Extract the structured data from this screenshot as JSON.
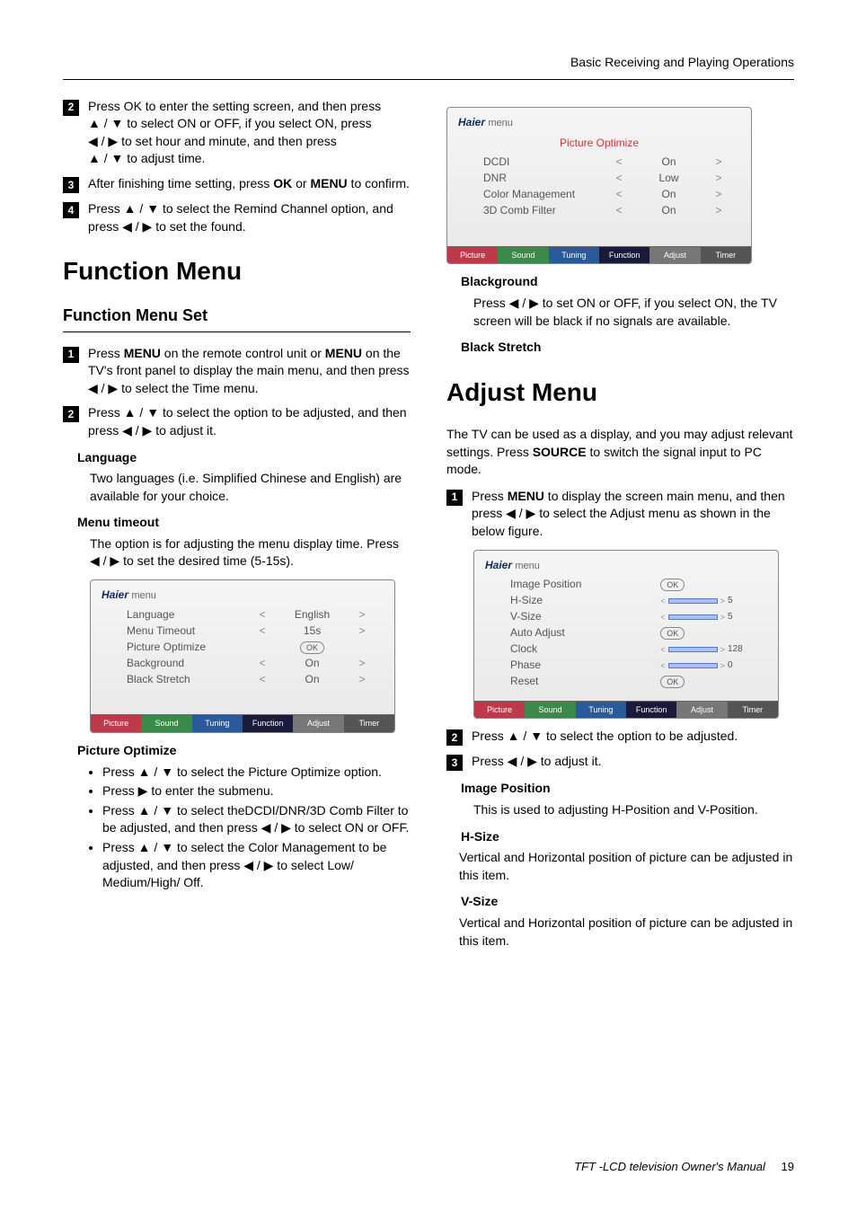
{
  "header": {
    "title": "Basic Receiving and Playing Operations"
  },
  "left": {
    "step2": {
      "l1": "Press OK to enter the setting screen, and then press",
      "l2a": "▲ / ▼ to select ON or OFF, if you select ON, press",
      "l3a": "◀ / ▶ to set hour and minute, and then press",
      "l4a": "▲ / ▼ to adjust time."
    },
    "step3": {
      "text_a": "After finishing time setting, press ",
      "ok": "OK",
      "or": " or ",
      "menu": "MENU",
      "text_b": " to confirm."
    },
    "step4": {
      "text_a": "Press ▲ / ▼ to select the Remind Channel option, and press ◀ / ▶ to set the found."
    },
    "h1": "Function Menu",
    "h2": "Function Menu Set",
    "fstep1": {
      "a": "Press ",
      "m": "MENU",
      "b": " on the remote control unit or ",
      "m2": "MENU",
      "c": " on the TV's front panel to display the main menu, and then press ◀ / ▶ to select the Time menu."
    },
    "fstep2": {
      "text": "Press ▲ / ▼ to select the option to be adjusted, and then press ◀ / ▶ to adjust it."
    },
    "lang_h": "Language",
    "lang_t": "Two languages (i.e. Simplified Chinese and English) are available for your choice.",
    "mt_h": "Menu timeout",
    "mt_t": "The option is for adjusting the menu display time. Press ◀ / ▶ to set the desired time (5-15s).",
    "menu1": {
      "brand": "Haier",
      "brand_sub": "menu",
      "rows": [
        {
          "lbl": "Language",
          "lt": "<",
          "val": "English",
          "gt": ">"
        },
        {
          "lbl": "Menu Timeout",
          "lt": "<",
          "val": "15s",
          "gt": ">"
        },
        {
          "lbl": "Picture Optimize",
          "ok": "OK"
        },
        {
          "lbl": "Background",
          "lt": "<",
          "val": "On",
          "gt": ">"
        },
        {
          "lbl": "Black Stretch",
          "lt": "<",
          "val": "On",
          "gt": ">"
        }
      ],
      "tabs": [
        "Picture",
        "Sound",
        "Tuning",
        "Function",
        "Adjust",
        "Timer"
      ]
    },
    "po_h": "Picture Optimize",
    "po_b1": "Press ▲ / ▼ to select the Picture Optimize option.",
    "po_b2": "Press ▶ to enter the submenu.",
    "po_b3": "Press ▲ / ▼ to select theDCDI/DNR/3D Comb Filter to be adjusted, and then press ◀ / ▶ to select ON or OFF.",
    "po_b4": "Press ▲ / ▼ to select the Color Management to be adjusted, and then press ◀ / ▶ to select Low/ Medium/High/ Off."
  },
  "right": {
    "menu2": {
      "brand": "Haier",
      "brand_sub": "menu",
      "heading": "Picture Optimize",
      "rows": [
        {
          "lbl": "DCDI",
          "lt": "<",
          "val": "On",
          "gt": ">"
        },
        {
          "lbl": "DNR",
          "lt": "<",
          "val": "Low",
          "gt": ">"
        },
        {
          "lbl": "Color Management",
          "lt": "<",
          "val": "On",
          "gt": ">"
        },
        {
          "lbl": "3D Comb Filter",
          "lt": "<",
          "val": "On",
          "gt": ">"
        }
      ],
      "tabs": [
        "Picture",
        "Sound",
        "Tuning",
        "Function",
        "Adjust",
        "Timer"
      ]
    },
    "bg_h": "Blackground",
    "bg_t": "Press ◀ / ▶ to set ON or OFF, if you select ON, the TV screen will be black if no signals are available.",
    "bs_h": "Black Stretch",
    "h1": "Adjust Menu",
    "intro_a": "The TV can be used as a display, and you may adjust relevant settings.  Press ",
    "intro_src": "SOURCE",
    "intro_b": " to switch the signal input to PC mode.",
    "astep1": {
      "a": "Press ",
      "m": "MENU",
      "b": " to display the screen main menu, and then press ◀ / ▶ to select the Adjust menu as shown in the below figure."
    },
    "menu3": {
      "brand": "Haier",
      "brand_sub": "menu",
      "rows": [
        {
          "lbl": "Image Position",
          "ok": "OK"
        },
        {
          "lbl": "H-Size",
          "bar": true,
          "num": "5"
        },
        {
          "lbl": "V-Size",
          "bar": true,
          "num": "5"
        },
        {
          "lbl": "Auto Adjust",
          "ok": "OK"
        },
        {
          "lbl": "Clock",
          "bar": true,
          "num": "128"
        },
        {
          "lbl": "Phase",
          "bar": true,
          "num": "0"
        },
        {
          "lbl": "Reset",
          "ok": "OK"
        }
      ],
      "tabs": [
        "Picture",
        "Sound",
        "Tuning",
        "Function",
        "Adjust",
        "Timer"
      ]
    },
    "astep2": "Press ▲ / ▼ to select the option to be adjusted.",
    "astep3": "Press ◀ / ▶ to adjust it.",
    "ip_h": "Image Position",
    "ip_t": "This is used to adjusting H-Position and V-Position.",
    "hs_h": "H-Size",
    "hs_t": "Vertical and Horizontal position of picture can be adjusted in this item.",
    "vs_h": "V-Size",
    "vs_t": "Vertical and Horizontal position of picture can be adjusted in this item."
  },
  "footer": {
    "text": "TFT -LCD television Owner's Manual",
    "page": "19"
  }
}
